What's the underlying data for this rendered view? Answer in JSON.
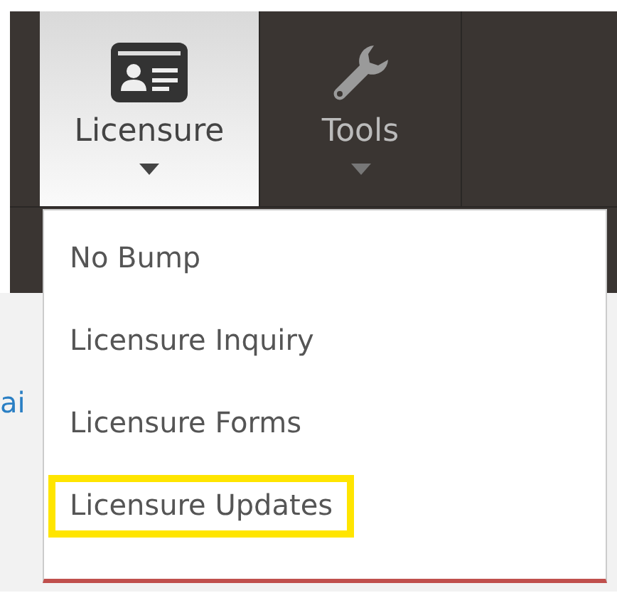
{
  "nav_tabs": [
    {
      "label": "Licensure",
      "kind": "card",
      "selected": true
    },
    {
      "label": "Tools",
      "kind": "tool",
      "selected": false
    }
  ],
  "page_text": "ai",
  "dropdown": {
    "items": [
      {
        "label": "No Bump",
        "highlighted": false
      },
      {
        "label": "Licensure Inquiry",
        "highlighted": false
      },
      {
        "label": "Licensure Forms",
        "highlighted": false
      },
      {
        "label": "Licensure Updates",
        "highlighted": true
      }
    ]
  }
}
